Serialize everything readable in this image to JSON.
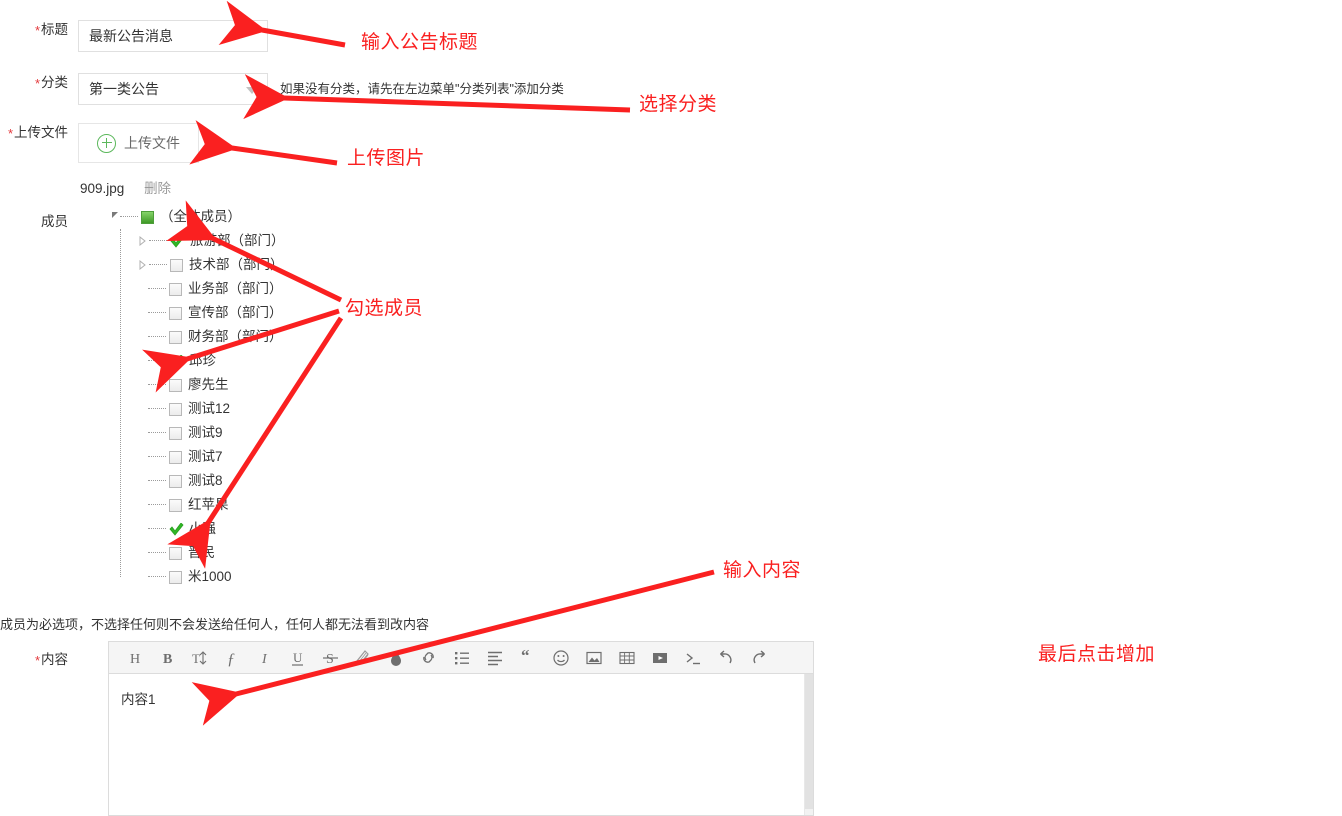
{
  "form": {
    "title_row": {
      "label": "标题",
      "required": true,
      "value": "最新公告消息"
    },
    "category_row": {
      "label": "分类",
      "required": true,
      "value": "第一类公告",
      "hint": "如果没有分类，请先在左边菜单\"分类列表\"添加分类"
    },
    "upload_row": {
      "label": "上传文件",
      "required": true,
      "button_label": "上传文件",
      "file_name": "909.jpg",
      "delete_label": "删除"
    },
    "member_row": {
      "label": "成员",
      "required": false,
      "note": "成员为必选项，不选择任何则不会发送给任何人，任何人都无法看到改内容"
    },
    "content_row": {
      "label": "内容",
      "required": true,
      "value": "内容1"
    }
  },
  "tree": {
    "root": {
      "label": "（全体成员）",
      "state": "partial",
      "expandable": true
    },
    "nodes": [
      {
        "label": "旅游部（部门）",
        "state": "checked",
        "expandable": true
      },
      {
        "label": "技术部（部门）",
        "state": "unchecked",
        "expandable": true
      },
      {
        "label": "业务部（部门）",
        "state": "unchecked",
        "expandable": false
      },
      {
        "label": "宣传部（部门）",
        "state": "unchecked",
        "expandable": false
      },
      {
        "label": "财务部（部门）",
        "state": "unchecked",
        "expandable": false
      },
      {
        "label": "邱珍",
        "state": "checked",
        "expandable": false
      },
      {
        "label": "廖先生",
        "state": "unchecked",
        "expandable": false
      },
      {
        "label": "测试12",
        "state": "unchecked",
        "expandable": false
      },
      {
        "label": "测试9",
        "state": "unchecked",
        "expandable": false
      },
      {
        "label": "测试7",
        "state": "unchecked",
        "expandable": false
      },
      {
        "label": "测试8",
        "state": "unchecked",
        "expandable": false
      },
      {
        "label": "红苹果",
        "state": "unchecked",
        "expandable": false
      },
      {
        "label": "小强",
        "state": "checked",
        "expandable": false
      },
      {
        "label": "晋民",
        "state": "unchecked",
        "expandable": false
      },
      {
        "label": "米1000",
        "state": "unchecked",
        "expandable": false
      }
    ]
  },
  "editor_toolbar": [
    {
      "icon": "heading-icon",
      "glyph": "H"
    },
    {
      "icon": "bold-icon",
      "glyph": "B"
    },
    {
      "icon": "font-size-icon",
      "glyph": "T↕"
    },
    {
      "icon": "font-family-icon",
      "glyph": "ƒ"
    },
    {
      "icon": "italic-icon",
      "glyph": "I"
    },
    {
      "icon": "underline-icon",
      "glyph": "U"
    },
    {
      "icon": "strikethrough-icon",
      "glyph": "S"
    },
    {
      "icon": "highlighter-icon",
      "glyph": "✎"
    },
    {
      "icon": "text-color-icon",
      "glyph": "●"
    },
    {
      "icon": "link-icon",
      "glyph": "🔗"
    },
    {
      "icon": "bullet-list-icon",
      "glyph": "☰"
    },
    {
      "icon": "align-icon",
      "glyph": "≡"
    },
    {
      "icon": "quote-icon",
      "glyph": "“"
    },
    {
      "icon": "emoji-icon",
      "glyph": "☺"
    },
    {
      "icon": "image-icon",
      "glyph": "▣"
    },
    {
      "icon": "table-icon",
      "glyph": "▦"
    },
    {
      "icon": "video-icon",
      "glyph": "▶"
    },
    {
      "icon": "code-icon",
      "glyph": ">_"
    },
    {
      "icon": "undo-icon",
      "glyph": "↶"
    },
    {
      "icon": "redo-icon",
      "glyph": "↷"
    }
  ],
  "annotations": {
    "color": "#fa2020",
    "items": [
      {
        "name": "annotation-title",
        "text": "输入公告标题"
      },
      {
        "name": "annotation-category",
        "text": "选择分类"
      },
      {
        "name": "annotation-upload",
        "text": "上传图片"
      },
      {
        "name": "annotation-members",
        "text": "勾选成员"
      },
      {
        "name": "annotation-content",
        "text": "输入内容"
      },
      {
        "name": "annotation-submit",
        "text": "最后点击增加"
      }
    ]
  }
}
